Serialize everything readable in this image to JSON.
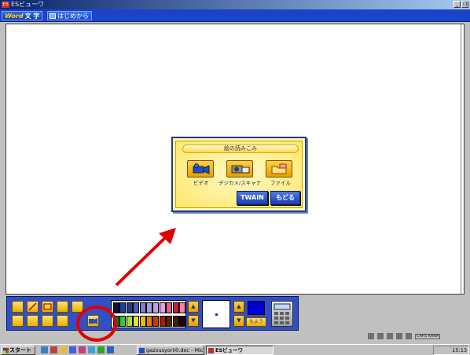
{
  "window": {
    "title": "ESビューワ"
  },
  "menubar": {
    "word_label": "Word",
    "moji_label": "文 字",
    "start_label": "はじめから"
  },
  "dialog": {
    "title": "絵の読みこみ",
    "buttons": [
      {
        "label": "ビデオ",
        "icon": "video-camera-icon"
      },
      {
        "label": "デジカメ/スキャナ",
        "icon": "digital-camera-scanner-icon"
      },
      {
        "label": "ファイル",
        "icon": "folder-icon"
      }
    ],
    "twain_label": "TWAIN",
    "back_label": "もどる"
  },
  "toolbar": {
    "tools": [
      "brush-tool-icon",
      "line-tool-icon",
      "rectangle-tool-icon",
      "stamp-tool-icon",
      "open-tool-icon",
      "paint-tool-icon",
      "eraser-tool-icon",
      "fill-tool-icon",
      "text-tool-icon",
      "video-capture-tool-icon"
    ],
    "palette_row1": [
      "#101040",
      "#2040a0",
      "#204080",
      "#4060c0",
      "#8080c0",
      "#a0a0e0",
      "#c0a0e0",
      "#e0a0e0",
      "#e06080",
      "#c02040",
      "#ff80a0"
    ],
    "palette_row2": [
      "#008000",
      "#40c040",
      "#a0e040",
      "#e0e040",
      "#e0c000",
      "#e08000",
      "#c04000",
      "#a02000",
      "#602000",
      "#402000",
      "#200000"
    ],
    "moyou_label": "もよう",
    "selected_color": "#0000d0",
    "accent": "#e00000"
  },
  "tray": {
    "caps_label": "CAPS KANA"
  },
  "taskbar": {
    "start_label": "スタート",
    "tasks": [
      {
        "label": "gazousyorii0.doc - Micros...",
        "icon": "word-doc-icon"
      },
      {
        "label": "ESビューワ",
        "icon": "es-viewer-icon",
        "active": true
      }
    ],
    "clock": "15:13"
  }
}
